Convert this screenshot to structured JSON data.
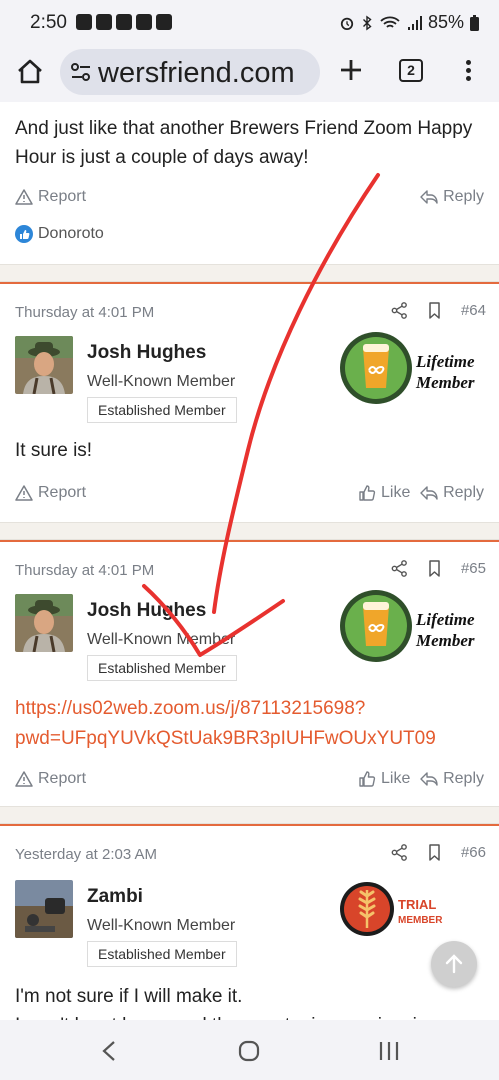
{
  "status_bar": {
    "time": "2:50",
    "battery": "85%"
  },
  "browser": {
    "url": "wersfriend.com",
    "tab_count": "2"
  },
  "post_prev": {
    "text_line1": "And just like that another Brewers Friend Zoom Happy",
    "text_line2": "Hour is just a couple of days away!",
    "report": "Report",
    "reply": "Reply",
    "reaction_user": "Donoroto"
  },
  "post_64": {
    "date": "Thursday at 4:01 PM",
    "number": "#64",
    "username": "Josh Hughes",
    "user_title": "Well-Known Member",
    "user_badge": "Established Member",
    "member_badge_line1": "Lifetime",
    "member_badge_line2": "Member",
    "body": "It sure is!",
    "report": "Report",
    "like": "Like",
    "reply": "Reply"
  },
  "post_65": {
    "date": "Thursday at 4:01 PM",
    "number": "#65",
    "username": "Josh Hughes",
    "user_title": "Well-Known Member",
    "user_badge": "Established Member",
    "member_badge_line1": "Lifetime",
    "member_badge_line2": "Member",
    "link_line1": "https://us02web.zoom.us/j/87113215698?",
    "link_line2": "pwd=UFpqYUVkQStUak9BR3pIUHFwOUxYUT09",
    "report": "Report",
    "like": "Like",
    "reply": "Reply"
  },
  "post_66": {
    "date": "Yesterday at 2:03 AM",
    "number": "#66",
    "username": "Zambi",
    "user_title": "Well-Known Member",
    "user_badge": "Established Member",
    "trial_badge_line1": "TRIAL",
    "trial_badge_line2": "MEMBER",
    "body_line1": "I'm not sure if I will make it.",
    "body_line2": "I won't be at home and the country is experiencing"
  },
  "colors": {
    "accent": "#e46a3e",
    "link": "#e45b2f",
    "annotation": "#e8322f"
  }
}
